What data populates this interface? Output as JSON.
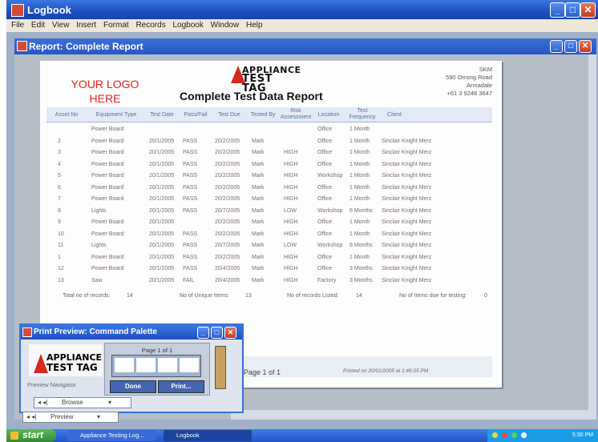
{
  "app": {
    "title": "Logbook",
    "menu": [
      "File",
      "Edit",
      "View",
      "Insert",
      "Format",
      "Records",
      "Logbook",
      "Window",
      "Help"
    ]
  },
  "child_window": {
    "title": "Report: Complete Report"
  },
  "report": {
    "logo_placeholder_line1": "YOUR LOGO",
    "logo_placeholder_line2": "HERE",
    "brand_line1": "APPLIANCE",
    "brand_line2": "TEST TAG",
    "title": "Complete Test Data Report",
    "address": [
      "SKM",
      "590 Orrong Road",
      "Armadale",
      "+61 3 9248 3647"
    ],
    "columns": [
      "Asset No",
      "Equipment Type",
      "Test Date",
      "Pass/Fail",
      "Test Due",
      "Tested By",
      "Risk Assessment",
      "Location",
      "Test Frequency",
      "Client"
    ],
    "rows": [
      [
        "",
        "Power Board",
        "",
        "",
        "",
        "",
        "",
        "Office",
        "1 Month",
        ""
      ],
      [
        "2",
        "Power Board",
        "20/1/2005",
        "PASS",
        "20/2/2005",
        "Mark",
        "",
        "Office",
        "1 Month",
        "Sinclair Knight Merz"
      ],
      [
        "3",
        "Power Board",
        "20/1/2005",
        "PASS",
        "20/2/2005",
        "Mark",
        "HIGH",
        "Office",
        "1 Month",
        "Sinclair Knight Merz"
      ],
      [
        "4",
        "Power Board",
        "20/1/2005",
        "PASS",
        "20/2/2005",
        "Mark",
        "HIGH",
        "Office",
        "1 Month",
        "Sinclair Knight Merz"
      ],
      [
        "5",
        "Power Board",
        "20/1/2005",
        "PASS",
        "20/2/2005",
        "Mark",
        "HIGH",
        "Workshop",
        "1 Month",
        "Sinclair Knight Merz"
      ],
      [
        "6",
        "Power Board",
        "20/1/2005",
        "PASS",
        "20/2/2005",
        "Mark",
        "HIGH",
        "Office",
        "1 Month",
        "Sinclair Knight Merz"
      ],
      [
        "7",
        "Power Board",
        "20/1/2005",
        "PASS",
        "20/2/2005",
        "Mark",
        "HIGH",
        "Office",
        "1 Month",
        "Sinclair Knight Merz"
      ],
      [
        "8",
        "Lights",
        "20/1/2005",
        "PASS",
        "20/7/2005",
        "Mark",
        "LOW",
        "Workshop",
        "6 Months",
        "Sinclair Knight Merz"
      ],
      [
        "9",
        "Power Board",
        "20/1/2005",
        "",
        "20/2/2005",
        "Mark",
        "HIGH",
        "Office",
        "1 Month",
        "Sinclair Knight Merz"
      ],
      [
        "10",
        "Power Board",
        "20/1/2005",
        "PASS",
        "20/2/2005",
        "Mark",
        "HIGH",
        "Office",
        "1 Month",
        "Sinclair Knight Merz"
      ],
      [
        "11",
        "Lights",
        "20/1/2005",
        "PASS",
        "20/7/2005",
        "Mark",
        "LOW",
        "Workshop",
        "6 Months",
        "Sinclair Knight Merz"
      ],
      [
        "1",
        "Power Board",
        "20/1/2005",
        "PASS",
        "20/2/2005",
        "Mark",
        "HIGH",
        "Office",
        "1 Month",
        "Sinclair Knight Merz"
      ],
      [
        "12",
        "Power Board",
        "20/1/2005",
        "PASS",
        "20/4/2005",
        "Mark",
        "HIGH",
        "Office",
        "3 Months",
        "Sinclair Knight Merz"
      ],
      [
        "13",
        "Saw",
        "20/1/2005",
        "FAIL",
        "20/4/2005",
        "Mark",
        "HIGH",
        "Factory",
        "3 Months",
        "Sinclair Knight Merz"
      ]
    ],
    "summary": {
      "total_label": "Total no of records:",
      "total_value": "14",
      "unique_label": "No of Unique Items:",
      "unique_value": "13",
      "listed_label": "No of records Listed:",
      "listed_value": "14",
      "due_label": "No of Items due for testing:",
      "due_value": "0"
    },
    "page_label": "Page 1 of 1",
    "printed_on": "Printed on 20/01/2005 at 1:46:05 PM"
  },
  "palette": {
    "title": "Print Preview: Command Palette",
    "page_indicator": "Page 1 of 1",
    "navigator_label": "Preview Navigator",
    "done_label": "Done",
    "print_label": "Print...",
    "combo1": "Browse",
    "combo2": "Preview"
  },
  "taskbar": {
    "start_label": "start",
    "tasks": [
      "Appliance Testing Log...",
      "Logbook"
    ],
    "clock": "5:30 PM"
  },
  "colors": {
    "accent_red": "#e32020",
    "xp_blue": "#2553c8"
  }
}
